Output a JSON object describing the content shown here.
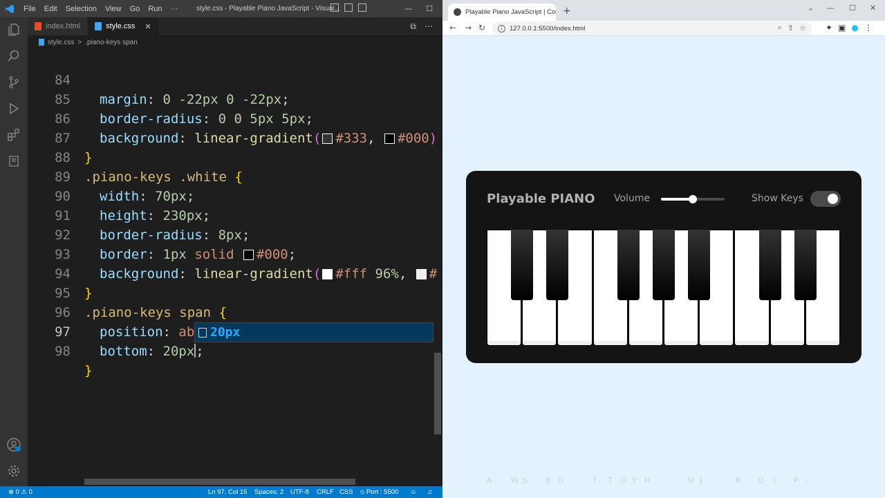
{
  "vscode": {
    "menu": [
      "File",
      "Edit",
      "Selection",
      "View",
      "Go",
      "Run"
    ],
    "window_title": "style.css - Playable Piano JavaScript - Visual...",
    "window_controls": {
      "minimize": "—",
      "maximize": "☐",
      "close": "✕"
    },
    "tabs": [
      {
        "label": "index.html",
        "active": false
      },
      {
        "label": "style.css",
        "active": true,
        "close": "✕"
      }
    ],
    "editor_actions": [
      "⧉",
      "⋯"
    ],
    "breadcrumb": {
      "file": "style.css",
      "separator": ">",
      "symbol": ".piano-keys span"
    },
    "line_numbers": [
      "84",
      "85",
      "86",
      "87",
      "88",
      "89",
      "90",
      "91",
      "92",
      "93",
      "94",
      "95",
      "96",
      "97",
      "98"
    ],
    "code": {
      "l84": {
        "prop": "margin",
        "v1": "0",
        "v2": "-22px",
        "v3": "0",
        "v4": "-22px"
      },
      "l85": {
        "prop": "border-radius",
        "v1": "0",
        "v2": "0",
        "v3": "5px",
        "v4": "5px"
      },
      "l86": {
        "prop": "background",
        "func": "linear-gradient",
        "c1": "#333",
        "c2": "#000",
        "close": ")"
      },
      "l88": {
        "sel1": ".piano-keys",
        "sel2": ".white"
      },
      "l89": {
        "prop": "width",
        "v": "70px"
      },
      "l90": {
        "prop": "height",
        "v": "230px"
      },
      "l91": {
        "prop": "border-radius",
        "v": "8px"
      },
      "l92": {
        "prop": "border",
        "v1": "1px",
        "v2": "solid",
        "c": "#000"
      },
      "l93": {
        "prop": "background",
        "func": "linear-gradient",
        "c1": "#fff",
        "p1": "96%",
        "c2": "#"
      },
      "l95": {
        "sel1": ".piano-keys",
        "sel2": "span"
      },
      "l96": {
        "prop": "position",
        "v": "absolute"
      },
      "l97": {
        "prop": "bottom",
        "v": "20px"
      }
    },
    "suggestion": {
      "text": "20px"
    },
    "status": {
      "problems": "⊗ 0 ⚠ 0",
      "position": "Ln 97, Col 15",
      "spaces": "Spaces: 2",
      "encoding": "UTF-8",
      "eol": "CRLF",
      "language": "CSS",
      "port": "⦸ Port : 5500"
    },
    "colors": {
      "accent": "#007acc",
      "selector": "#d7ba7d",
      "property": "#9cdcfe",
      "number": "#b5cea8",
      "string": "#ce9178"
    }
  },
  "browser": {
    "tab_title": "Playable Piano JavaScript | Codin",
    "tab_close": "✕",
    "new_tab": "+",
    "url": "127.0.0.1:5500/index.html",
    "window_controls": {
      "chevron": "⌄",
      "minimize": "—",
      "maximize": "☐",
      "close": "✕"
    },
    "nav": {
      "back": "←",
      "forward": "→",
      "reload": "↻"
    },
    "omnibox_icons": [
      "⌕",
      "⇪",
      "☆"
    ],
    "toolbar_icons": [
      "✦",
      "▣",
      "●",
      "⋮"
    ]
  },
  "piano": {
    "title": "Playable PIANO",
    "volume_label": "Volume",
    "volume_level": 0.5,
    "show_keys_label": "Show Keys",
    "show_keys_on": true,
    "white_keys": 10,
    "black_key_after_white": [
      0,
      1,
      3,
      4,
      5,
      7,
      8
    ],
    "hints": [
      "A",
      "W",
      "S",
      "E",
      "D",
      "F",
      "T",
      "G",
      "Y",
      "H",
      "U",
      "J",
      "K",
      "O",
      "L",
      "P",
      ";"
    ]
  }
}
